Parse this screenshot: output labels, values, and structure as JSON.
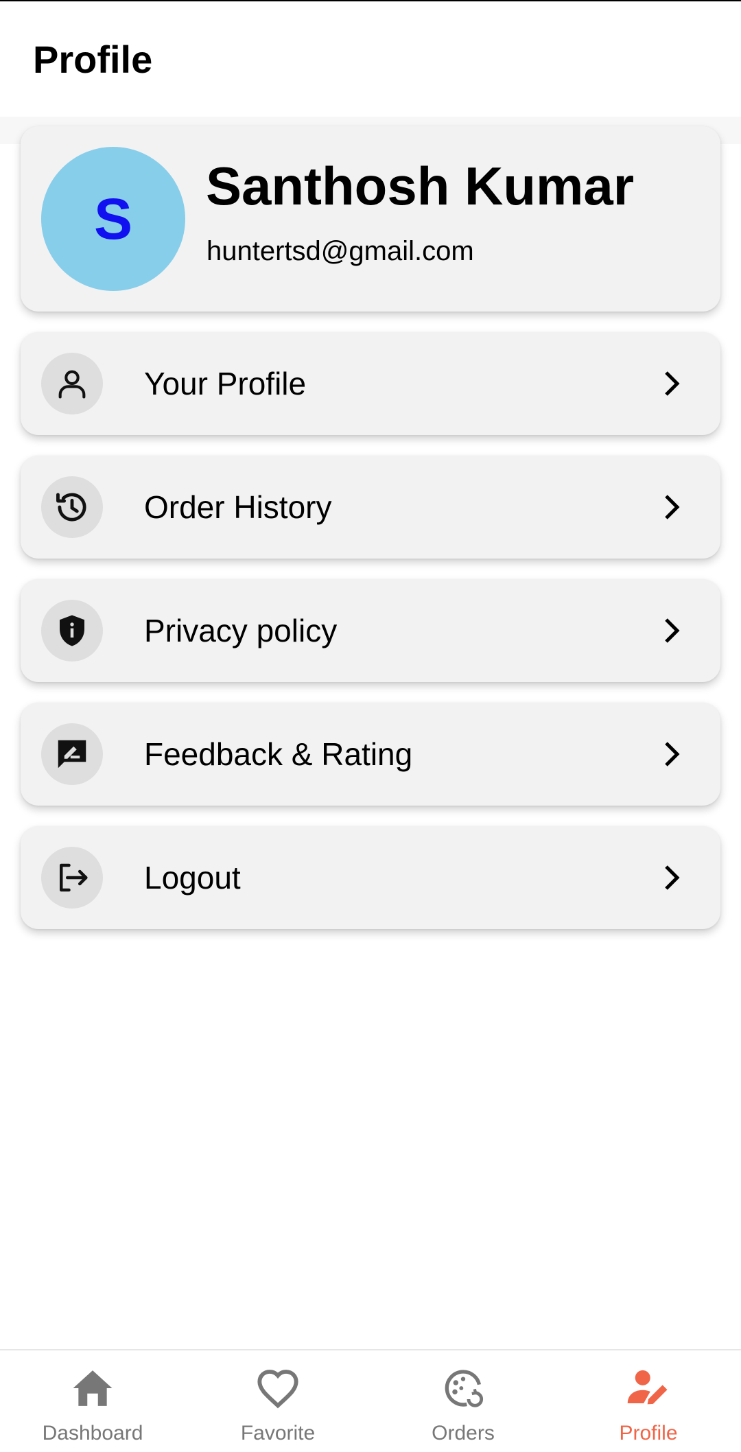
{
  "app_bar": {
    "title": "Profile"
  },
  "profile": {
    "avatar_initial": "S",
    "name": "Santhosh Kumar",
    "email": "huntertsd@gmail.com",
    "avatar_color": "#87ceeb",
    "initial_color": "#1010f0"
  },
  "menu": {
    "items": [
      {
        "label": "Your Profile",
        "icon": "person-icon"
      },
      {
        "label": "Order History",
        "icon": "history-icon"
      },
      {
        "label": "Privacy policy",
        "icon": "shield-info-icon"
      },
      {
        "label": "Feedback & Rating",
        "icon": "rate-review-icon"
      },
      {
        "label": "Logout",
        "icon": "logout-icon"
      }
    ]
  },
  "bottom_nav": {
    "items": [
      {
        "label": "Dashboard",
        "icon": "home-icon",
        "active": false
      },
      {
        "label": "Favorite",
        "icon": "heart-icon",
        "active": false
      },
      {
        "label": "Orders",
        "icon": "orders-icon",
        "active": false
      },
      {
        "label": "Profile",
        "icon": "profile-edit-icon",
        "active": true
      }
    ],
    "active_color": "#f06548",
    "inactive_color": "#777777"
  }
}
